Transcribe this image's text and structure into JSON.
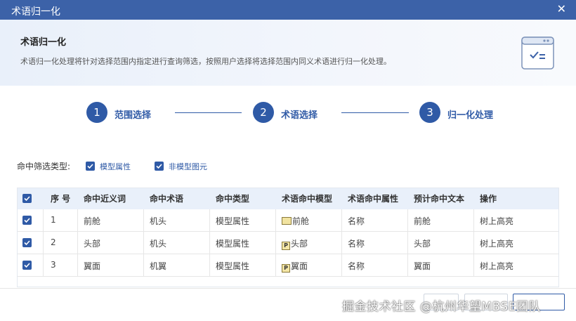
{
  "window": {
    "title": "术语归一化",
    "close_glyph": "✕"
  },
  "header": {
    "title": "术语归一化",
    "description": "术语归一化处理将针对选择范围内指定进行查询筛选，按照用户选择将选择范围内同义术语进行归一化处理。",
    "icon": "checklist-window-icon"
  },
  "steps": [
    {
      "number": "1",
      "label": "范围选择"
    },
    {
      "number": "2",
      "label": "术语选择"
    },
    {
      "number": "3",
      "label": "归一化处理"
    }
  ],
  "filter": {
    "label": "命中筛选类型:",
    "options": [
      {
        "label": "模型属性",
        "checked": true
      },
      {
        "label": "非模型图元",
        "checked": true
      }
    ]
  },
  "table": {
    "headers": [
      "序 号",
      "命中近义词",
      "命中术语",
      "命中类型",
      "术语命中模型",
      "术语命中属性",
      "预计命中文本",
      "操作"
    ],
    "rows": [
      {
        "checked": true,
        "index": "1",
        "synonym": "前舱",
        "term": "机头",
        "hit_type": "模型属性",
        "model_icon": "block-icon",
        "model": "前舱",
        "attribute": "名称",
        "expected_text": "前舱",
        "action": "树上高亮"
      },
      {
        "checked": true,
        "index": "2",
        "synonym": "头部",
        "term": "机头",
        "hit_type": "模型属性",
        "model_icon": "part-p-icon",
        "model": "头部",
        "attribute": "名称",
        "expected_text": "头部",
        "action": "树上高亮"
      },
      {
        "checked": true,
        "index": "3",
        "synonym": "翼面",
        "term": "机翼",
        "hit_type": "模型属性",
        "model_icon": "part-p-icon",
        "model": "翼面",
        "attribute": "名称",
        "expected_text": "翼面",
        "action": "树上高亮"
      }
    ]
  },
  "footer": {
    "watermark": "掘金技术社区 @杭州华望MBSE团队"
  },
  "colors": {
    "titlebar": "#3c62a8",
    "accent": "#2f5aa6",
    "link": "#2f6fc8",
    "table_header": "#e9f0fa"
  }
}
